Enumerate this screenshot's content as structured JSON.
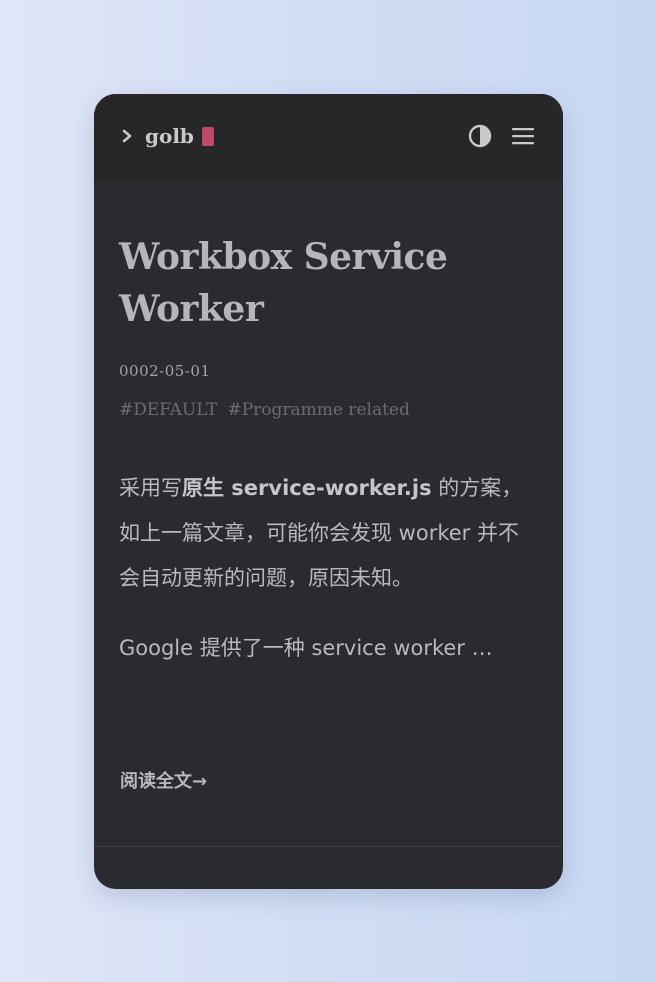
{
  "site": {
    "name": "golb"
  },
  "header": {
    "theme_icon": "contrast-half-circle-icon",
    "menu_icon": "hamburger-menu-icon",
    "prompt_icon": "chevron-right-icon",
    "cursor_color": "#c2496b"
  },
  "post": {
    "title": "Workbox Service Worker",
    "date": "0002-05-01",
    "tags": [
      "#DEFAULT",
      "#Programme related"
    ],
    "excerpt": {
      "p1_prefix": "采用写",
      "p1_bold": "原生 service-worker.js",
      "p1_suffix": " 的方案，如上一篇文章，可能你会发现 worker 并不会自动更新的问题，原因未知。",
      "p2": "Google 提供了一种 service worker …"
    },
    "read_more": "阅读全文→"
  },
  "colors": {
    "background_start": "#dfe6f7",
    "background_end": "#c7d8f3",
    "card": "#2a2b2e",
    "header": "#262729",
    "text": "#b9b9bd"
  }
}
